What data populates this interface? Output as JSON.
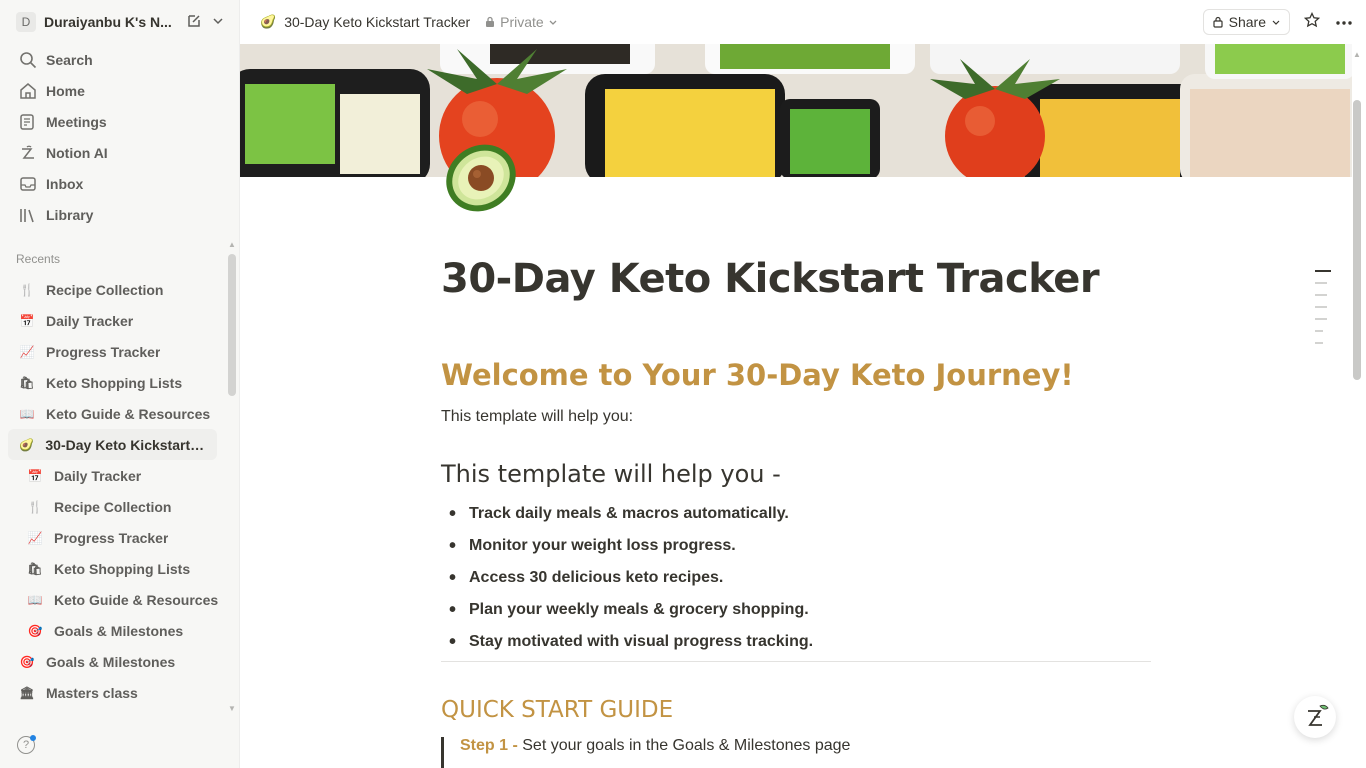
{
  "workspace": {
    "avatar_letter": "D",
    "name": "Duraiyanbu K's N..."
  },
  "nav": [
    {
      "label": "Search",
      "icon": "search-icon"
    },
    {
      "label": "Home",
      "icon": "home-icon"
    },
    {
      "label": "Meetings",
      "icon": "meetings-icon"
    },
    {
      "label": "Notion AI",
      "icon": "notion-ai-icon"
    },
    {
      "label": "Inbox",
      "icon": "inbox-icon"
    },
    {
      "label": "Library",
      "icon": "library-icon"
    }
  ],
  "recents": {
    "label": "Recents",
    "items": [
      {
        "label": "Recipe Collection",
        "emoji": "🍴",
        "sub": false
      },
      {
        "label": "Daily Tracker",
        "emoji": "📅",
        "sub": false
      },
      {
        "label": "Progress Tracker",
        "emoji": "📈",
        "sub": false
      },
      {
        "label": "Keto Shopping Lists",
        "emoji": "🛍",
        "sub": false
      },
      {
        "label": "Keto Guide & Resources",
        "emoji": "📖",
        "sub": false
      },
      {
        "label": "30-Day Keto Kickstart T...",
        "emoji": "🥑",
        "sub": false,
        "active": true
      },
      {
        "label": "Daily Tracker",
        "emoji": "📅",
        "sub": true
      },
      {
        "label": "Recipe Collection",
        "emoji": "🍴",
        "sub": true
      },
      {
        "label": "Progress Tracker",
        "emoji": "📈",
        "sub": true
      },
      {
        "label": "Keto Shopping Lists",
        "emoji": "🛍",
        "sub": true
      },
      {
        "label": "Keto Guide & Resources",
        "emoji": "📖",
        "sub": true
      },
      {
        "label": "Goals & Milestones",
        "emoji": "🎯",
        "sub": true
      },
      {
        "label": "Goals & Milestones",
        "emoji": "🎯",
        "sub": false
      },
      {
        "label": "Masters class",
        "emoji": "🏛",
        "sub": false
      }
    ]
  },
  "topbar": {
    "page_emoji": "🥑",
    "breadcrumb": "30-Day Keto Kickstart Tracker",
    "privacy": "Private",
    "share_label": "Share"
  },
  "page": {
    "title": "30-Day Keto Kickstart Tracker",
    "welcome_heading": "Welcome to Your 30-Day Keto Journey!",
    "intro": "This template will help you:",
    "help_heading": "This template will help you -",
    "bullets": [
      "Track daily meals & macros automatically.",
      "Monitor your weight loss progress.",
      "Access 30 delicious keto recipes.",
      "Plan your weekly meals & grocery shopping.",
      "Stay motivated with visual progress tracking."
    ],
    "quick_start_heading": "QUICK START GUIDE",
    "step1_label": "Step 1 -",
    "step1_text": " Set your goals in the Goals & Milestones page"
  },
  "colors": {
    "accent_gold": "#c29343",
    "text": "#37352f",
    "sidebar_bg": "#f7f7f5"
  }
}
